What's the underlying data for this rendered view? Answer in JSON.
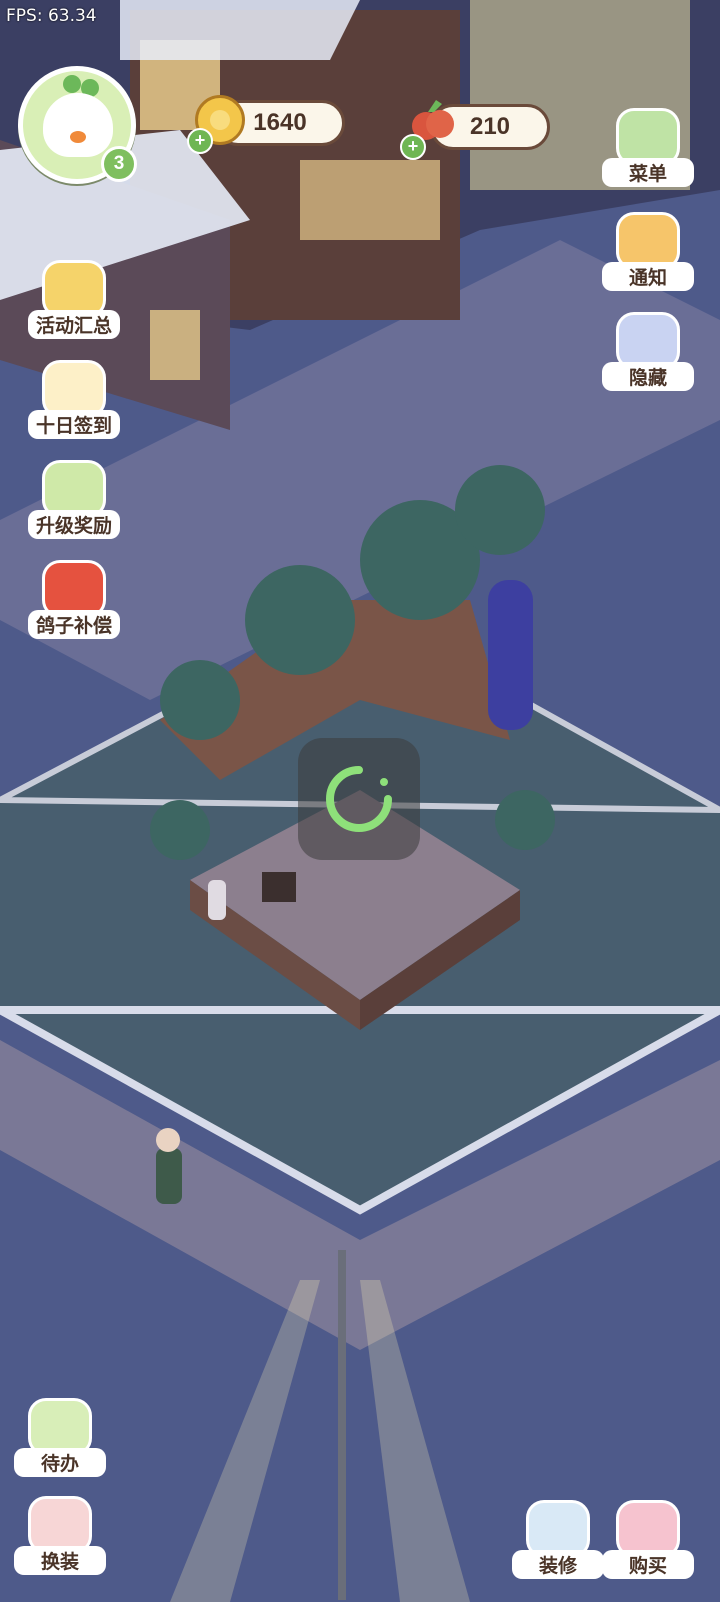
{
  "debug": {
    "fps": "FPS: 63.34"
  },
  "player": {
    "level": "3"
  },
  "currency": {
    "coins": "1640",
    "fruit": "210"
  },
  "left_menu": [
    {
      "label": "活动汇总",
      "icon": "crown-icon"
    },
    {
      "label": "十日签到",
      "icon": "calendar-checkin-icon"
    },
    {
      "label": "升级奖励",
      "icon": "upgrade-arrows-icon"
    },
    {
      "label": "鸽子补偿",
      "icon": "pigeon-envelope-icon"
    }
  ],
  "right_menu": [
    {
      "label": "菜单",
      "icon": "menu-gift-icon"
    },
    {
      "label": "通知",
      "icon": "bell-icon"
    },
    {
      "label": "隐藏",
      "icon": "hide-frame-icon"
    }
  ],
  "bottom_left": [
    {
      "label": "待办",
      "icon": "todo-clipboard-icon"
    },
    {
      "label": "换装",
      "icon": "outfit-character-icon"
    }
  ],
  "bottom_right": [
    {
      "label": "装修",
      "icon": "builder-duck-icon"
    },
    {
      "label": "购买",
      "icon": "shopping-bag-icon"
    }
  ],
  "colors": {
    "accent_green": "#7fbf5f",
    "label_text": "#4a3428",
    "loader": "#8ee07a"
  }
}
